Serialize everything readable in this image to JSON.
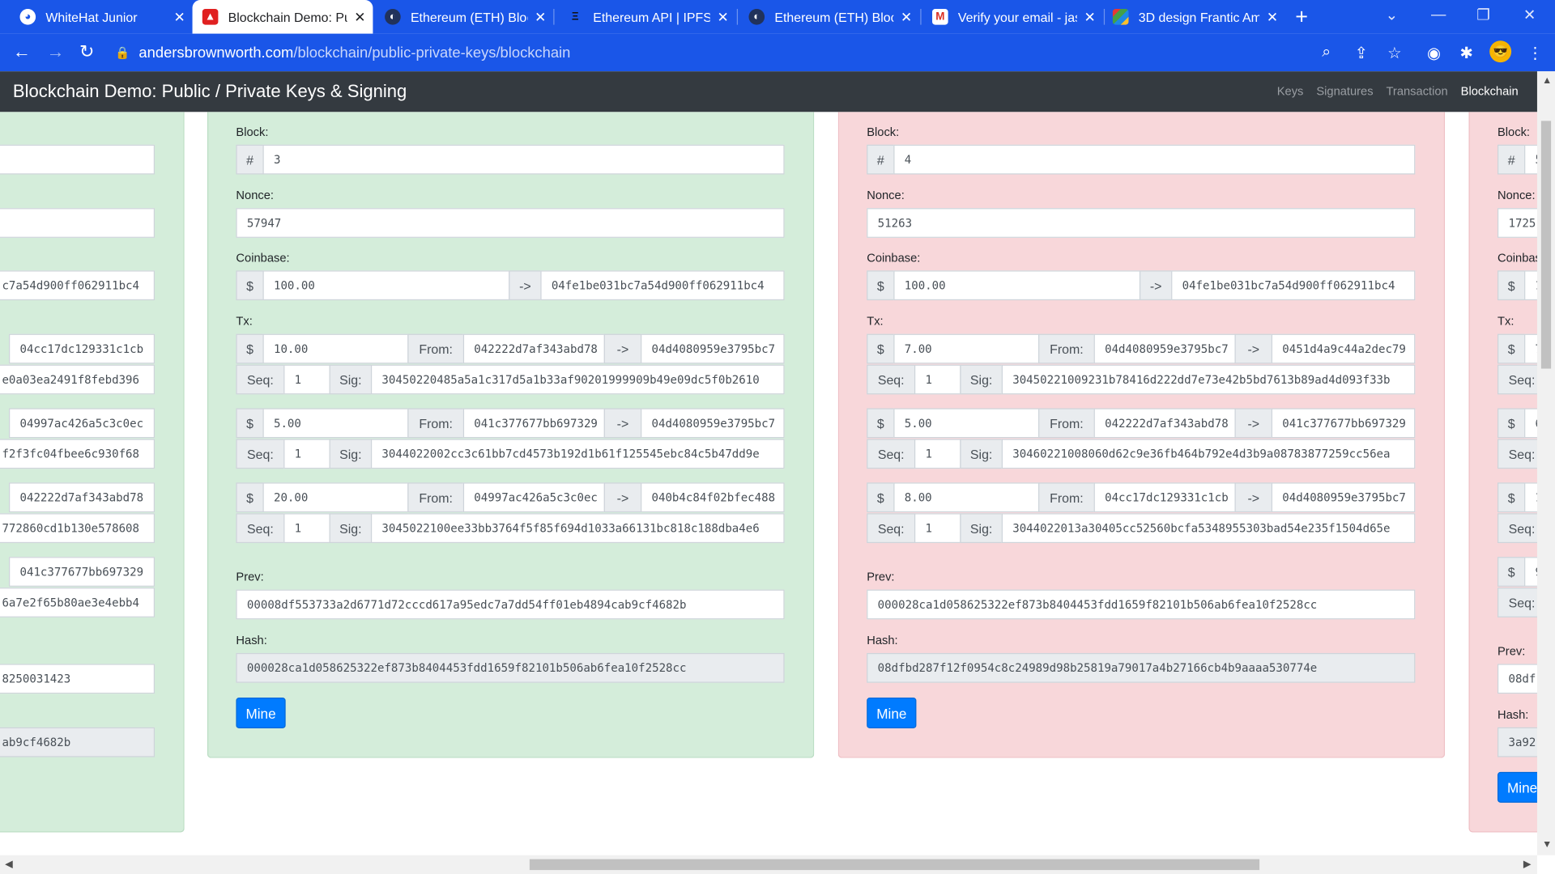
{
  "tabs": [
    {
      "title": "WhiteHat Junior",
      "icon": "whitehat-favicon"
    },
    {
      "title": "Blockchain Demo: Pul",
      "icon": "andersbrownworth-favicon",
      "active": true
    },
    {
      "title": "Ethereum (ETH) Block",
      "icon": "etherscan-favicon"
    },
    {
      "title": "Ethereum API | IPFS A",
      "icon": "infura-favicon"
    },
    {
      "title": "Ethereum (ETH) Block",
      "icon": "etherscan-favicon"
    },
    {
      "title": "Verify your email - jas",
      "icon": "gmail-favicon"
    },
    {
      "title": "3D design Frantic Am",
      "icon": "tinkercad-favicon"
    }
  ],
  "address_bar": {
    "host": "andersbrownworth.com",
    "path": "/blockchain/public-private-keys/blockchain"
  },
  "app": {
    "title": "Blockchain Demo: Public / Private Keys & Signing",
    "nav": [
      "Keys",
      "Signatures",
      "Transaction",
      "Blockchain"
    ],
    "active_nav": "Blockchain"
  },
  "labels": {
    "block": "Block:",
    "nonce": "Nonce:",
    "coinbase": "Coinbase:",
    "tx": "Tx:",
    "prev": "Prev:",
    "hash": "Hash:",
    "mine": "Mine",
    "hash_sign": "#",
    "dollar": "$",
    "arrow": "->",
    "from": "From:",
    "seq": "Seq:",
    "sig": "Sig:"
  },
  "partial_left": {
    "coinbase_to": "c7a54d900ff062911bc4",
    "txs": [
      {
        "to": "04cc17dc129331c1cb",
        "sig": "e0a03ea2491f8febd396"
      },
      {
        "to": "04997ac426a5c3c0ec",
        "sig": "f2f3fc04fbee6c930f68"
      },
      {
        "to": "042222d7af343abd78",
        "sig": "772860cd1b130e578608"
      },
      {
        "to": "041c377677bb697329",
        "sig": "6a7e2f65b80ae3e4ebb4"
      }
    ],
    "prev": "8250031423",
    "hash": "ab9cf4682b"
  },
  "blocks": [
    {
      "number": "3",
      "nonce": "57947",
      "coinbase_amount": "100.00",
      "coinbase_to": "04fe1be031bc7a54d900ff062911bc4",
      "txs": [
        {
          "amount": "10.00",
          "from": "042222d7af343abd78",
          "to": "04d4080959e3795bc7",
          "seq": "1",
          "sig": "30450220485a5a1c317d5a1b33af90201999909b49e09dc5f0b2610"
        },
        {
          "amount": "5.00",
          "from": "041c377677bb697329",
          "to": "04d4080959e3795bc7",
          "seq": "1",
          "sig": "3044022002cc3c61bb7cd4573b192d1b61f125545ebc84c5b47dd9e"
        },
        {
          "amount": "20.00",
          "from": "04997ac426a5c3c0ec",
          "to": "040b4c84f02bfec488",
          "seq": "1",
          "sig": "3045022100ee33bb3764f5f85f694d1033a66131bc818c188dba4e6"
        }
      ],
      "prev": "00008df553733a2d6771d72cccd617a95edc7a7dd54ff01eb4894cab9cf4682b",
      "hash": "000028ca1d058625322ef873b8404453fdd1659f82101b506ab6fea10f2528cc"
    },
    {
      "number": "4",
      "nonce": "51263",
      "coinbase_amount": "100.00",
      "coinbase_to": "04fe1be031bc7a54d900ff062911bc4",
      "txs": [
        {
          "amount": "7.00",
          "from": "04d4080959e3795bc7",
          "to": "0451d4a9c44a2dec79",
          "seq": "1",
          "sig": "30450221009231b78416d222dd7e73e42b5bd7613b89ad4d093f33b"
        },
        {
          "amount": "5.00",
          "from": "042222d7af343abd78",
          "to": "041c377677bb697329",
          "seq": "1",
          "sig": "30460221008060d62c9e36fb464b792e4d3b9a08783877259cc56ea"
        },
        {
          "amount": "8.00",
          "from": "04cc17dc129331c1cb",
          "to": "04d4080959e3795bc7",
          "seq": "1",
          "sig": "3044022013a30405cc52560bcfa5348955303bad54e235f1504d65e"
        }
      ],
      "prev": "000028ca1d058625322ef873b8404453fdd1659f82101b506ab6fea10f2528cc",
      "hash": "08dfbd287f12f0954c8c24989d98b25819a79017a4b27166cb4b9aaaa530774e"
    }
  ],
  "partial_right": {
    "block": "5",
    "nonce": "1725",
    "coinbase_amount": "1",
    "tx_amounts": [
      "7",
      "6",
      "1",
      "9"
    ],
    "prev": "08df",
    "hash": "3a92"
  }
}
